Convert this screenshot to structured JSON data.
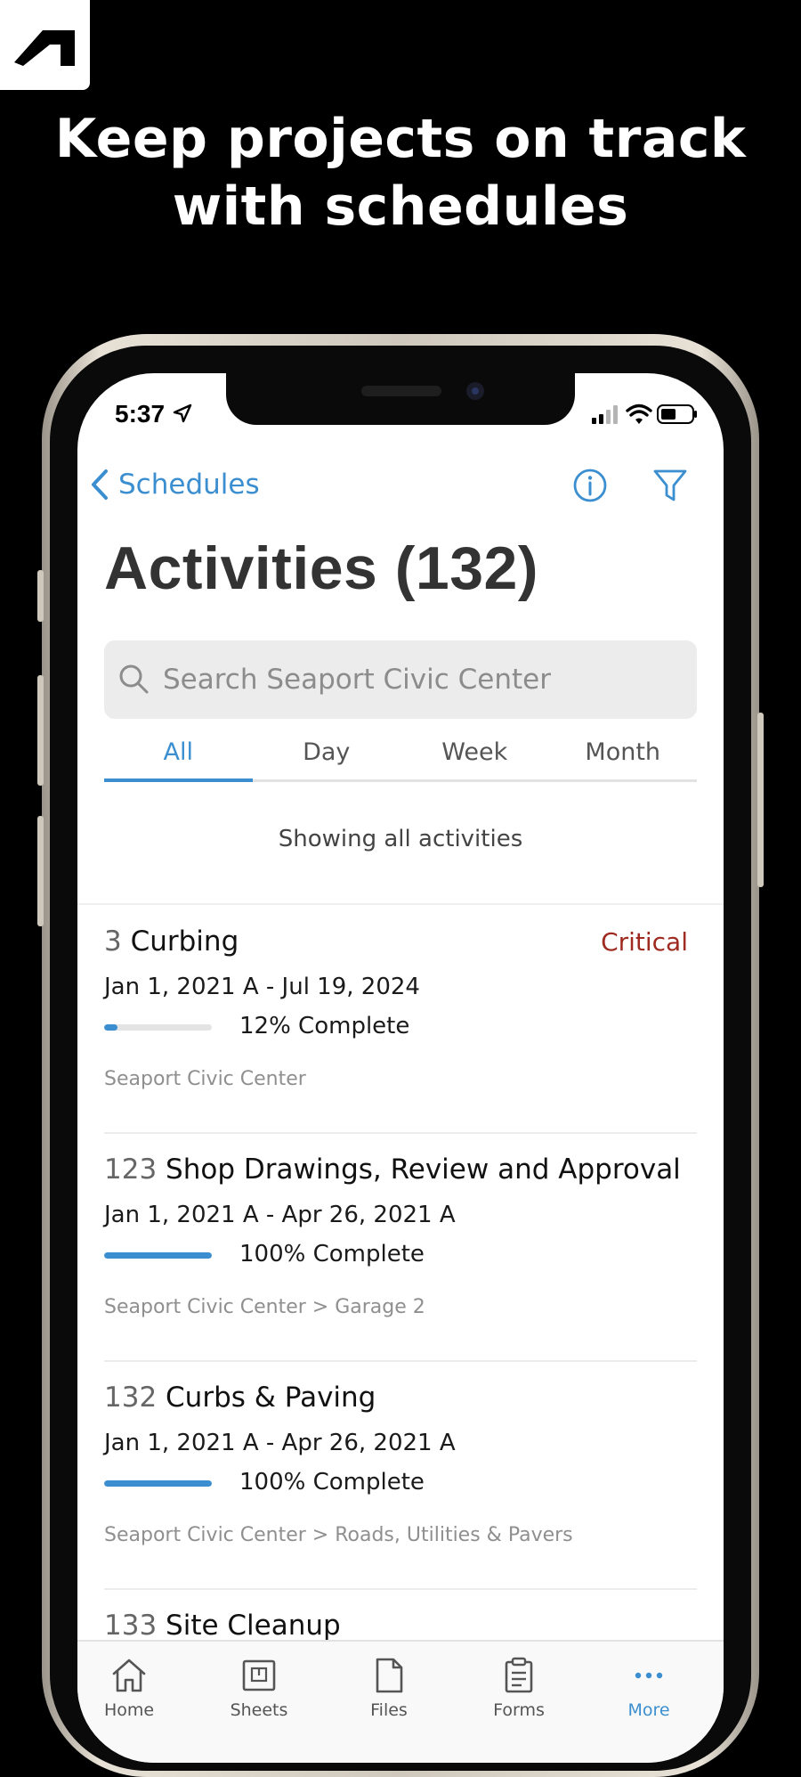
{
  "promo": {
    "headline_line1": "Keep projects on track",
    "headline_line2": "with schedules"
  },
  "status_bar": {
    "time": "5:37"
  },
  "nav": {
    "back_label": "Schedules",
    "info_icon": "info-icon",
    "filter_icon": "filter-icon"
  },
  "page": {
    "title": "Activities (132)"
  },
  "search": {
    "placeholder": "Search Seaport Civic Center"
  },
  "tabs": [
    {
      "label": "All",
      "active": true
    },
    {
      "label": "Day",
      "active": false
    },
    {
      "label": "Week",
      "active": false
    },
    {
      "label": "Month",
      "active": false
    }
  ],
  "showing_text": "Showing all activities",
  "activities": [
    {
      "id": "3",
      "name": "Curbing",
      "badge": "Critical",
      "dates": "Jan 1, 2021 A - Jul 19, 2024",
      "progress": 12,
      "progress_label": "12% Complete",
      "path": "Seaport Civic Center"
    },
    {
      "id": "123",
      "name": "Shop Drawings, Review and Approval",
      "badge": "",
      "dates": "Jan 1, 2021 A - Apr 26, 2021 A",
      "progress": 100,
      "progress_label": "100% Complete",
      "path": "Seaport Civic Center > Garage 2"
    },
    {
      "id": "132",
      "name": "Curbs & Paving",
      "badge": "",
      "dates": "Jan 1, 2021 A - Apr 26, 2021 A",
      "progress": 100,
      "progress_label": "100% Complete",
      "path": "Seaport Civic Center > Roads, Utilities & Pavers"
    },
    {
      "id": "133",
      "name": "Site Cleanup",
      "badge": "",
      "dates": "",
      "progress_label": "",
      "path": ""
    }
  ],
  "tabbar": [
    {
      "label": "Home",
      "icon": "home-icon",
      "active": false
    },
    {
      "label": "Sheets",
      "icon": "sheets-icon",
      "active": false
    },
    {
      "label": "Files",
      "icon": "files-icon",
      "active": false
    },
    {
      "label": "Forms",
      "icon": "forms-icon",
      "active": false
    },
    {
      "label": "More",
      "icon": "more-icon",
      "active": true
    }
  ],
  "colors": {
    "accent": "#3b8fd0",
    "critical": "#9e2a20"
  }
}
